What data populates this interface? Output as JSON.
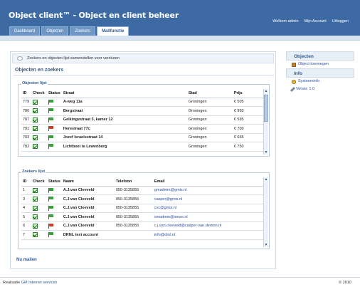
{
  "header": {
    "title": "Object client™ - Object en client beheer",
    "links": [
      "Welkom admin",
      "Mijn Account",
      "Uitloggen"
    ]
  },
  "tabs": [
    {
      "label": "Dashboard",
      "active": false
    },
    {
      "label": "Objecten",
      "active": false
    },
    {
      "label": "Zoekers",
      "active": false
    },
    {
      "label": "Mailfunctie",
      "active": true
    }
  ],
  "notice": "Zoekers en objecten lijst samenstellen voor versturen",
  "section_title": "Objecten en zoekers",
  "objects": {
    "legend": "Objecten lijst",
    "columns": [
      "ID",
      "Check",
      "Status",
      "Straat",
      "Stad",
      "Prijs"
    ],
    "rows": [
      {
        "id": "779",
        "checked": true,
        "status": "green",
        "street": "A-weg 11a",
        "city": "Groningen",
        "price": "€ 505"
      },
      {
        "id": "780",
        "checked": true,
        "status": "green",
        "street": "Bergstraat",
        "city": "Groningen",
        "price": "€ 950"
      },
      {
        "id": "787",
        "checked": true,
        "status": "green",
        "street": "Gelkingestraat 3, kamer 12",
        "city": "Groningen",
        "price": "€ 595"
      },
      {
        "id": "791",
        "checked": true,
        "status": "red",
        "street": "Herestraat 77c",
        "city": "Groningen",
        "price": "€ 700"
      },
      {
        "id": "783",
        "checked": true,
        "status": "green",
        "street": "Jozef Israelsstraat 14",
        "city": "Groningen",
        "price": "€ 665"
      },
      {
        "id": "782",
        "checked": true,
        "status": "green",
        "street": "Lichtboei te Lewenborg",
        "city": "Groningen",
        "price": "€ 750"
      }
    ]
  },
  "seekers": {
    "legend": "Zoekers lijst",
    "columns": [
      "ID",
      "Check",
      "Status",
      "Naam",
      "Telefoon",
      "Email"
    ],
    "rows": [
      {
        "id": "1",
        "checked": true,
        "status": "green",
        "name": "A.J.van Cleeveld",
        "phone": "050-3135855",
        "email": "gmadmin@gmis.nl"
      },
      {
        "id": "3",
        "checked": true,
        "status": "green",
        "name": "C.J.van Cleeveld",
        "phone": "050-3135855",
        "email": "casper@gmis.nl"
      },
      {
        "id": "4",
        "checked": true,
        "status": "green",
        "name": "C.J.van Cleeveld",
        "phone": "050-3135855",
        "email": "cvc@gmis.nl"
      },
      {
        "id": "5",
        "checked": true,
        "status": "green",
        "name": "C.J.van Cleeveld",
        "phone": "050-3135855",
        "email": "smadmin@smzo.nl"
      },
      {
        "id": "6",
        "checked": true,
        "status": "red",
        "name": "C.J.van Cleeveld",
        "phone": "050-3135855",
        "email": "c.j.van.cleeveld@casper-van.demon.nl"
      },
      {
        "id": "7",
        "checked": true,
        "status": "green",
        "name": "DRNL test account",
        "phone": "",
        "email": "info@drnl.nl"
      }
    ]
  },
  "send_link": "Nu mailen",
  "sidebar": {
    "sections": [
      {
        "title": "Objecten",
        "items": [
          {
            "label": "Object toevoegen",
            "icon": "box-icon"
          }
        ]
      },
      {
        "title": "Info",
        "items": [
          {
            "label": "Systeeminfo",
            "icon": "person-icon"
          },
          {
            "label": "Versie: 1.0",
            "icon": "pencil-icon"
          }
        ]
      }
    ]
  },
  "footer": {
    "prefix": "Realisatie",
    "brand": "GM Internet services",
    "copyright": "© 2010"
  },
  "colors": {
    "header": "#3d6aa3",
    "accent": "#2f5a8f",
    "link": "#2c4fa0"
  }
}
